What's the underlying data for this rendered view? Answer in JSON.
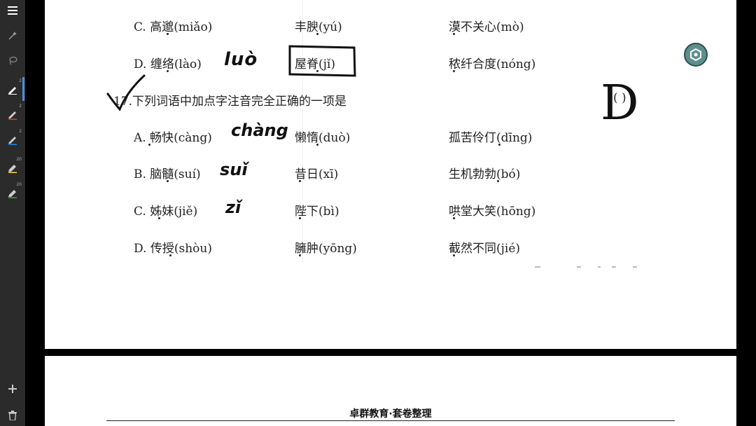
{
  "toolbar": {
    "items": [
      {
        "name": "menu",
        "icon": "menu-icon"
      },
      {
        "name": "magic",
        "icon": "magic-wand-icon"
      },
      {
        "name": "lasso",
        "icon": "lasso-icon"
      },
      {
        "name": "pen-black",
        "icon": "pen-icon",
        "size": "2",
        "color": "#ffffff"
      },
      {
        "name": "pen-red",
        "icon": "pen-icon",
        "size": "2",
        "color": "#e53935"
      },
      {
        "name": "pen-blue",
        "icon": "pen-icon",
        "size": "2",
        "color": "#1e88e5"
      },
      {
        "name": "highlighter-yellow",
        "icon": "highlighter-icon",
        "size": "20",
        "color": "#fdd835"
      },
      {
        "name": "highlighter-green",
        "icon": "highlighter-icon",
        "size": "20",
        "color": "#43a047"
      }
    ],
    "add_icon": "plus-icon",
    "delete_icon": "trash-icon"
  },
  "prev_question": {
    "rows": [
      [
        "C. 高邈(miǎo)",
        "丰腴(yú)",
        "漠不关心(mò)"
      ],
      [
        "D. 缠络(lào)",
        "屋脊(jǐ)",
        "秾纤合度(nóng)"
      ]
    ]
  },
  "question17": {
    "stem": "17.下列词语中加点字注音完全正确的一项是",
    "paren": "(        )",
    "rows": [
      [
        "A. 畅快(càng)",
        "懒惰(duò)",
        "孤苦伶仃(dīng)"
      ],
      [
        "B. 脑髓(suí)",
        "昔日(xī)",
        "生机勃勃(bó)"
      ],
      [
        "C. 姊妹(jiě)",
        "陛下(bì)",
        "哄堂大笑(hōng)"
      ],
      [
        "D. 传授(shòu)",
        "臃肿(yōng)",
        "截然不同(jié)"
      ]
    ]
  },
  "handwriting": {
    "luo": "luò",
    "chang": "chàng",
    "sui": "suǐ",
    "zi": "zǐ",
    "answer": "D"
  },
  "footer": {
    "title": "卓群教育·套卷整理"
  }
}
